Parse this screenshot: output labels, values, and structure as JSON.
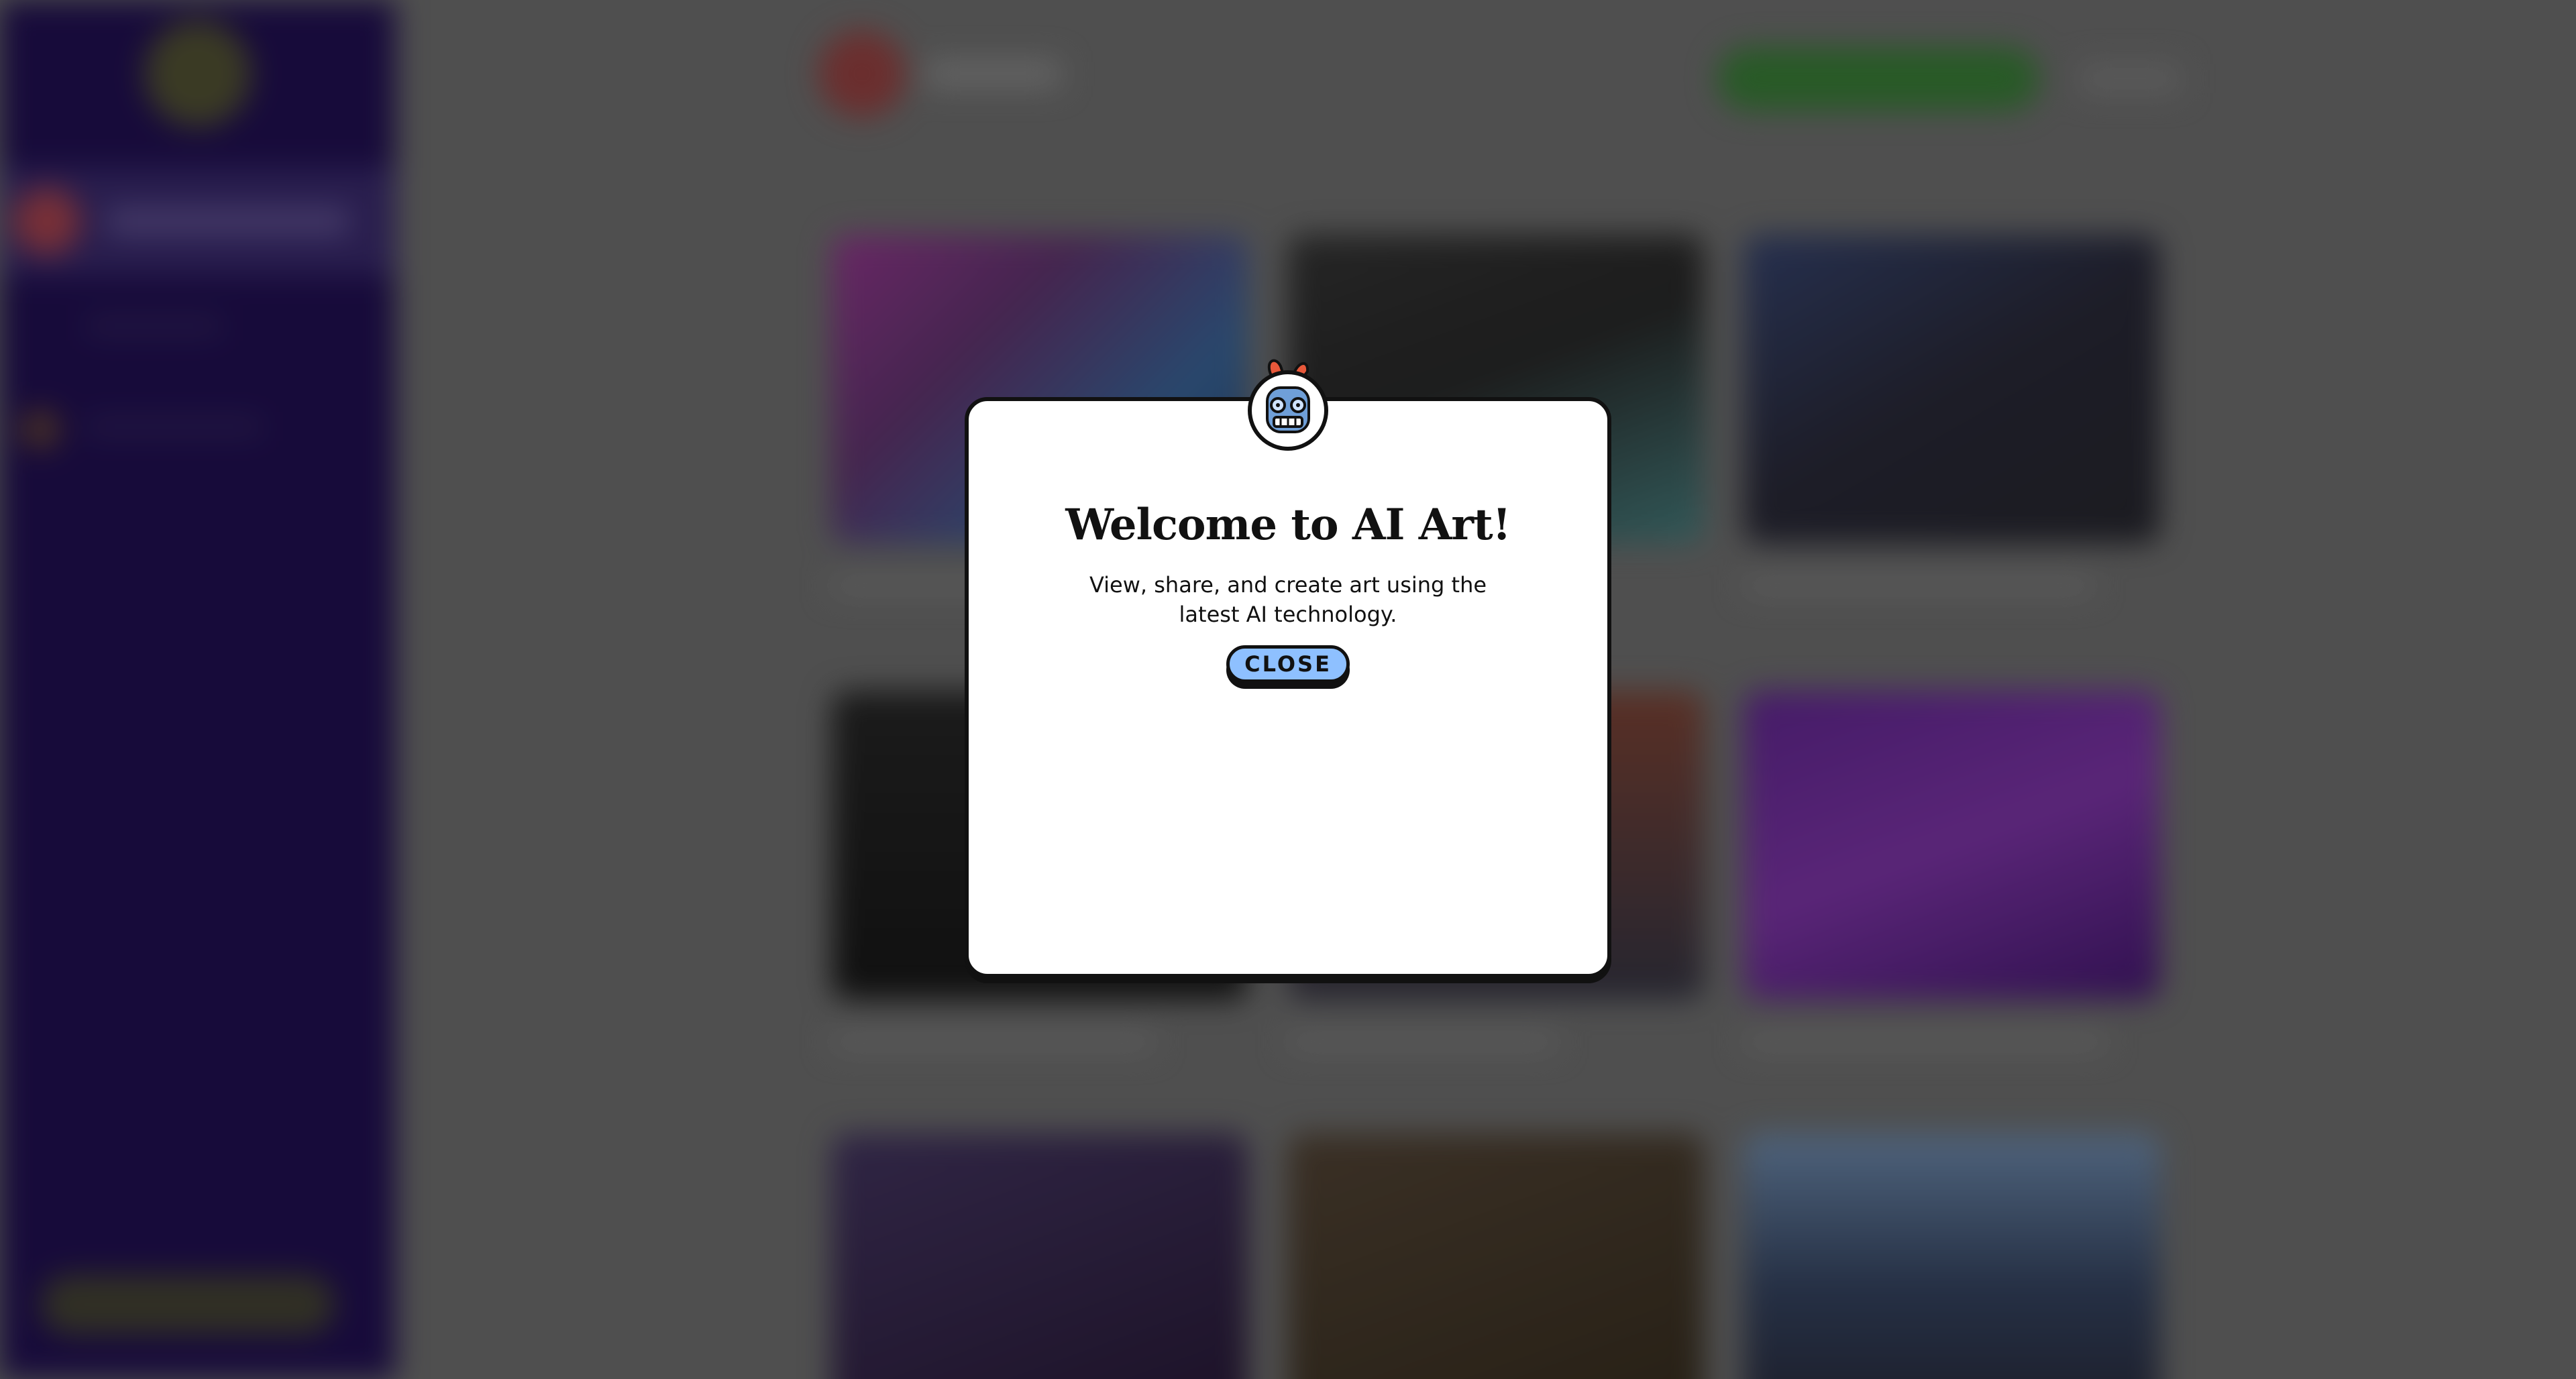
{
  "modal": {
    "title": "Welcome to AI Art!",
    "description": "View, share, and create art using the latest AI technology.",
    "close_label": "CLOSE",
    "mascot_icon": "robot-mascot-icon"
  },
  "colors": {
    "modal_bg": "#ffffff",
    "border": "#111111",
    "button_bg": "#8ec0ff",
    "sidebar_bg": "#24115a",
    "overlay": "rgba(0,0,0,0.35)"
  }
}
